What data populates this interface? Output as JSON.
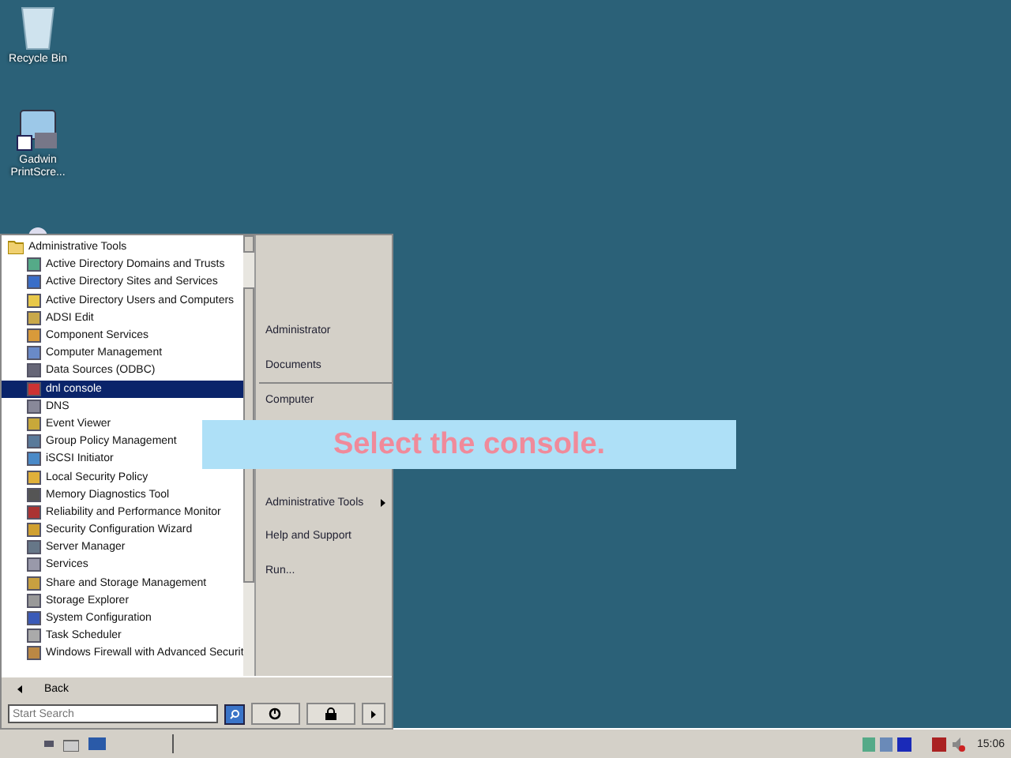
{
  "desktop_icons": [
    {
      "label": "Recycle Bin",
      "kind": "bin"
    },
    {
      "label": "Gadwin PrintScre...",
      "kind": "app"
    },
    {
      "kind": "disc"
    }
  ],
  "start_menu": {
    "programs": {
      "label": "Administrative Tools",
      "expanded": true,
      "children": [
        {
          "label": "Active Directory Domains and Trusts",
          "selected": false
        },
        {
          "label": "Active Directory Sites and Services",
          "selected": false
        },
        {
          "label": "Active Directory Users and Computers",
          "selected": false
        },
        {
          "label": "ADSI Edit",
          "selected": false
        },
        {
          "label": "Component Services",
          "selected": false
        },
        {
          "label": "Computer Management",
          "selected": false
        },
        {
          "label": "Data Sources (ODBC)",
          "selected": false
        },
        {
          "label": "dnl console",
          "selected": true
        },
        {
          "label": "DNS",
          "selected": false
        },
        {
          "label": "Event Viewer",
          "selected": false
        },
        {
          "label": "Group Policy Management",
          "selected": false
        },
        {
          "label": "iSCSI Initiator",
          "selected": false
        },
        {
          "label": "Local Security Policy",
          "selected": false
        },
        {
          "label": "Memory Diagnostics Tool",
          "selected": false
        },
        {
          "label": "Reliability and Performance Monitor",
          "selected": false
        },
        {
          "label": "Security Configuration Wizard",
          "selected": false
        },
        {
          "label": "Server Manager",
          "selected": false
        },
        {
          "label": "Services",
          "selected": false
        },
        {
          "label": "Share and Storage Management",
          "selected": false
        },
        {
          "label": "Storage Explorer",
          "selected": false
        },
        {
          "label": "System Configuration",
          "selected": false
        },
        {
          "label": "Task Scheduler",
          "selected": false
        },
        {
          "label": "Windows Firewall with Advanced Securit",
          "selected": false
        }
      ]
    },
    "back": "Back",
    "search": {
      "placeholder": "Start Search"
    },
    "right_items": [
      {
        "label": "Administrator",
        "submenu": false
      },
      {
        "label": "Documents",
        "submenu": false
      },
      {
        "kind": "divider"
      },
      {
        "label": "Computer",
        "submenu": false
      },
      {
        "kind": "gap"
      },
      {
        "kind": "gap"
      },
      {
        "label": "Administrative Tools",
        "submenu": true
      },
      {
        "label": "Help and Support",
        "submenu": false
      },
      {
        "label": "Run...",
        "submenu": false
      }
    ]
  },
  "tooltip": "Select the console.",
  "taskbar": {
    "clock": "15:06"
  }
}
